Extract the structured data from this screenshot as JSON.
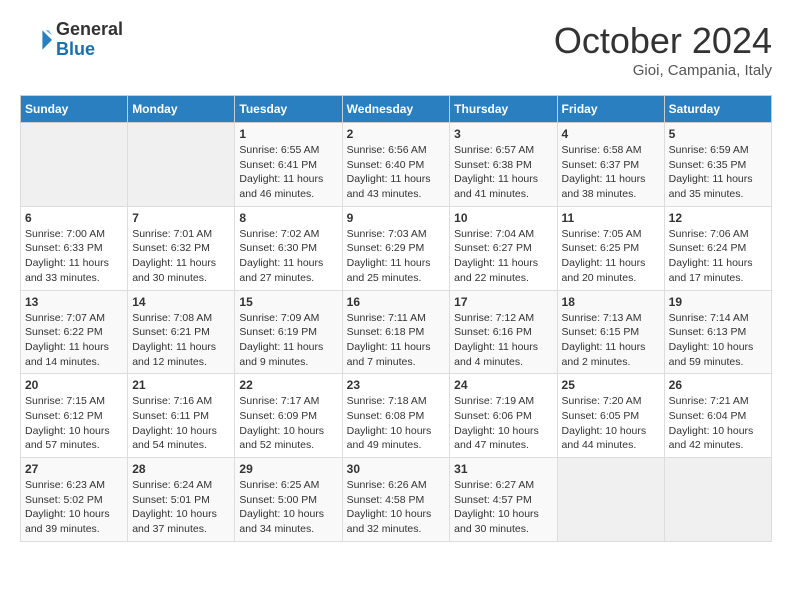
{
  "header": {
    "logo_general": "General",
    "logo_blue": "Blue",
    "month_title": "October 2024",
    "subtitle": "Gioi, Campania, Italy"
  },
  "weekdays": [
    "Sunday",
    "Monday",
    "Tuesday",
    "Wednesday",
    "Thursday",
    "Friday",
    "Saturday"
  ],
  "weeks": [
    [
      {
        "day": "",
        "sunrise": "",
        "sunset": "",
        "daylight": ""
      },
      {
        "day": "",
        "sunrise": "",
        "sunset": "",
        "daylight": ""
      },
      {
        "day": "1",
        "sunrise": "Sunrise: 6:55 AM",
        "sunset": "Sunset: 6:41 PM",
        "daylight": "Daylight: 11 hours and 46 minutes."
      },
      {
        "day": "2",
        "sunrise": "Sunrise: 6:56 AM",
        "sunset": "Sunset: 6:40 PM",
        "daylight": "Daylight: 11 hours and 43 minutes."
      },
      {
        "day": "3",
        "sunrise": "Sunrise: 6:57 AM",
        "sunset": "Sunset: 6:38 PM",
        "daylight": "Daylight: 11 hours and 41 minutes."
      },
      {
        "day": "4",
        "sunrise": "Sunrise: 6:58 AM",
        "sunset": "Sunset: 6:37 PM",
        "daylight": "Daylight: 11 hours and 38 minutes."
      },
      {
        "day": "5",
        "sunrise": "Sunrise: 6:59 AM",
        "sunset": "Sunset: 6:35 PM",
        "daylight": "Daylight: 11 hours and 35 minutes."
      }
    ],
    [
      {
        "day": "6",
        "sunrise": "Sunrise: 7:00 AM",
        "sunset": "Sunset: 6:33 PM",
        "daylight": "Daylight: 11 hours and 33 minutes."
      },
      {
        "day": "7",
        "sunrise": "Sunrise: 7:01 AM",
        "sunset": "Sunset: 6:32 PM",
        "daylight": "Daylight: 11 hours and 30 minutes."
      },
      {
        "day": "8",
        "sunrise": "Sunrise: 7:02 AM",
        "sunset": "Sunset: 6:30 PM",
        "daylight": "Daylight: 11 hours and 27 minutes."
      },
      {
        "day": "9",
        "sunrise": "Sunrise: 7:03 AM",
        "sunset": "Sunset: 6:29 PM",
        "daylight": "Daylight: 11 hours and 25 minutes."
      },
      {
        "day": "10",
        "sunrise": "Sunrise: 7:04 AM",
        "sunset": "Sunset: 6:27 PM",
        "daylight": "Daylight: 11 hours and 22 minutes."
      },
      {
        "day": "11",
        "sunrise": "Sunrise: 7:05 AM",
        "sunset": "Sunset: 6:25 PM",
        "daylight": "Daylight: 11 hours and 20 minutes."
      },
      {
        "day": "12",
        "sunrise": "Sunrise: 7:06 AM",
        "sunset": "Sunset: 6:24 PM",
        "daylight": "Daylight: 11 hours and 17 minutes."
      }
    ],
    [
      {
        "day": "13",
        "sunrise": "Sunrise: 7:07 AM",
        "sunset": "Sunset: 6:22 PM",
        "daylight": "Daylight: 11 hours and 14 minutes."
      },
      {
        "day": "14",
        "sunrise": "Sunrise: 7:08 AM",
        "sunset": "Sunset: 6:21 PM",
        "daylight": "Daylight: 11 hours and 12 minutes."
      },
      {
        "day": "15",
        "sunrise": "Sunrise: 7:09 AM",
        "sunset": "Sunset: 6:19 PM",
        "daylight": "Daylight: 11 hours and 9 minutes."
      },
      {
        "day": "16",
        "sunrise": "Sunrise: 7:11 AM",
        "sunset": "Sunset: 6:18 PM",
        "daylight": "Daylight: 11 hours and 7 minutes."
      },
      {
        "day": "17",
        "sunrise": "Sunrise: 7:12 AM",
        "sunset": "Sunset: 6:16 PM",
        "daylight": "Daylight: 11 hours and 4 minutes."
      },
      {
        "day": "18",
        "sunrise": "Sunrise: 7:13 AM",
        "sunset": "Sunset: 6:15 PM",
        "daylight": "Daylight: 11 hours and 2 minutes."
      },
      {
        "day": "19",
        "sunrise": "Sunrise: 7:14 AM",
        "sunset": "Sunset: 6:13 PM",
        "daylight": "Daylight: 10 hours and 59 minutes."
      }
    ],
    [
      {
        "day": "20",
        "sunrise": "Sunrise: 7:15 AM",
        "sunset": "Sunset: 6:12 PM",
        "daylight": "Daylight: 10 hours and 57 minutes."
      },
      {
        "day": "21",
        "sunrise": "Sunrise: 7:16 AM",
        "sunset": "Sunset: 6:11 PM",
        "daylight": "Daylight: 10 hours and 54 minutes."
      },
      {
        "day": "22",
        "sunrise": "Sunrise: 7:17 AM",
        "sunset": "Sunset: 6:09 PM",
        "daylight": "Daylight: 10 hours and 52 minutes."
      },
      {
        "day": "23",
        "sunrise": "Sunrise: 7:18 AM",
        "sunset": "Sunset: 6:08 PM",
        "daylight": "Daylight: 10 hours and 49 minutes."
      },
      {
        "day": "24",
        "sunrise": "Sunrise: 7:19 AM",
        "sunset": "Sunset: 6:06 PM",
        "daylight": "Daylight: 10 hours and 47 minutes."
      },
      {
        "day": "25",
        "sunrise": "Sunrise: 7:20 AM",
        "sunset": "Sunset: 6:05 PM",
        "daylight": "Daylight: 10 hours and 44 minutes."
      },
      {
        "day": "26",
        "sunrise": "Sunrise: 7:21 AM",
        "sunset": "Sunset: 6:04 PM",
        "daylight": "Daylight: 10 hours and 42 minutes."
      }
    ],
    [
      {
        "day": "27",
        "sunrise": "Sunrise: 6:23 AM",
        "sunset": "Sunset: 5:02 PM",
        "daylight": "Daylight: 10 hours and 39 minutes."
      },
      {
        "day": "28",
        "sunrise": "Sunrise: 6:24 AM",
        "sunset": "Sunset: 5:01 PM",
        "daylight": "Daylight: 10 hours and 37 minutes."
      },
      {
        "day": "29",
        "sunrise": "Sunrise: 6:25 AM",
        "sunset": "Sunset: 5:00 PM",
        "daylight": "Daylight: 10 hours and 34 minutes."
      },
      {
        "day": "30",
        "sunrise": "Sunrise: 6:26 AM",
        "sunset": "Sunset: 4:58 PM",
        "daylight": "Daylight: 10 hours and 32 minutes."
      },
      {
        "day": "31",
        "sunrise": "Sunrise: 6:27 AM",
        "sunset": "Sunset: 4:57 PM",
        "daylight": "Daylight: 10 hours and 30 minutes."
      },
      {
        "day": "",
        "sunrise": "",
        "sunset": "",
        "daylight": ""
      },
      {
        "day": "",
        "sunrise": "",
        "sunset": "",
        "daylight": ""
      }
    ]
  ]
}
